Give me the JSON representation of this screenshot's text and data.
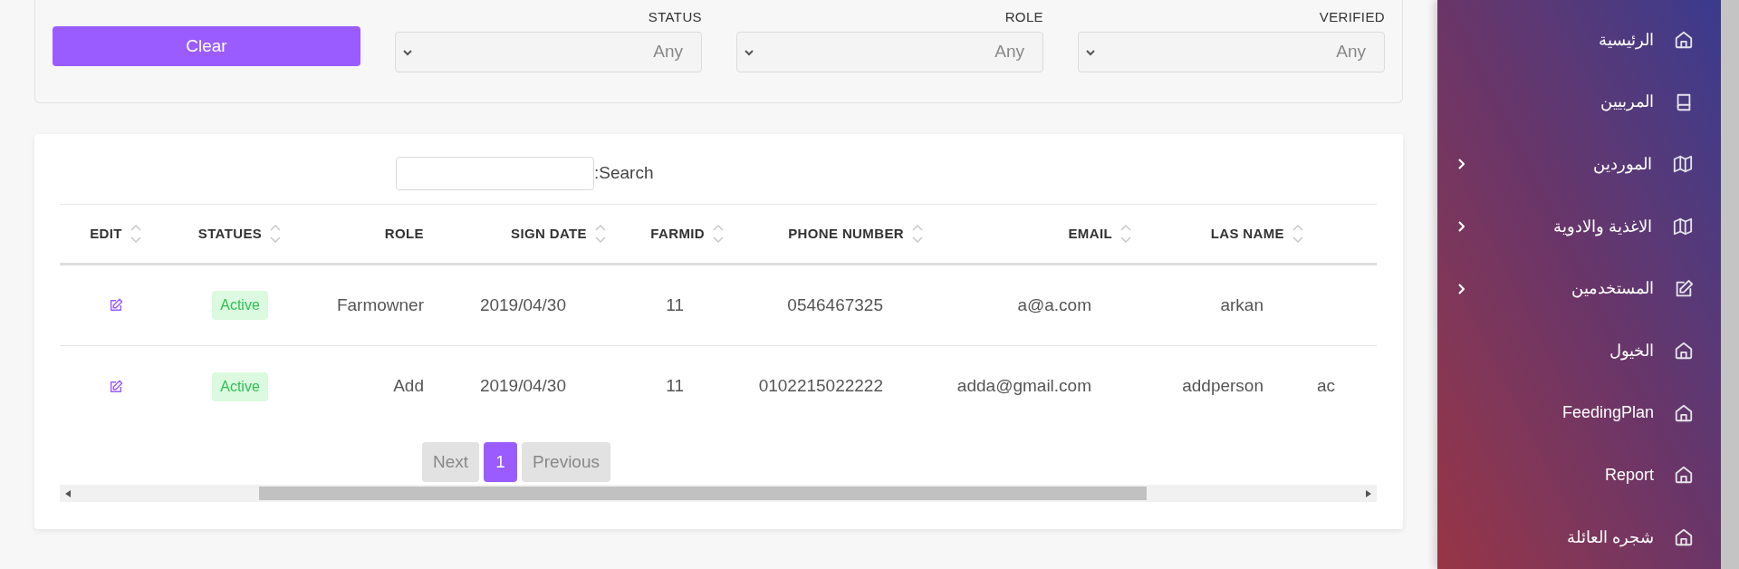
{
  "filters": {
    "clear_button": "Clear",
    "selects": [
      {
        "label": "STATUS",
        "value": "Any"
      },
      {
        "label": "ROLE",
        "value": "Any"
      },
      {
        "label": "VERIFIED",
        "value": "Any"
      }
    ]
  },
  "table": {
    "search_label": ":Search",
    "columns": [
      {
        "label": "EDIT",
        "sortable": true
      },
      {
        "label": "STATUES",
        "sortable": true
      },
      {
        "label": "ROLE",
        "sortable": false
      },
      {
        "label": "SIGN DATE",
        "sortable": true
      },
      {
        "label": "FARMID",
        "sortable": true
      },
      {
        "label": "PHONE NUMBER",
        "sortable": true
      },
      {
        "label": "EMAIL",
        "sortable": true
      },
      {
        "label": "LAS NAME",
        "sortable": true
      },
      {
        "sortable": false
      }
    ],
    "rows": [
      {
        "cells": [
          "",
          "Active",
          "Farmowner",
          "2019/04/30",
          "11",
          "0546467325",
          "a@a.com",
          "arkan"
        ]
      },
      {
        "cells": [
          "",
          "Active",
          "Add",
          "2019/04/30",
          "11",
          "0102215022222",
          "adda@gmail.com",
          "addperson",
          "ac"
        ]
      }
    ]
  },
  "pagination": {
    "next": "Next",
    "pages": [
      {
        "label": "1",
        "selected": true
      }
    ],
    "previous": "Previous"
  },
  "sidebar": {
    "items": [
      {
        "label": "الرئيسية",
        "kind": "home",
        "expandable": false
      },
      {
        "label": "المربيين",
        "kind": "book",
        "expandable": false
      },
      {
        "label": "الموردين",
        "kind": "map",
        "expandable": true
      },
      {
        "label": "الاغذية والادوية",
        "kind": "map",
        "expandable": true
      },
      {
        "label": "المستخدمين",
        "kind": "edit",
        "expandable": true
      },
      {
        "label": "الخيول",
        "kind": "home",
        "expandable": false
      },
      {
        "label": "FeedingPlan",
        "kind": "home",
        "expandable": false
      },
      {
        "label": "Report",
        "kind": "home",
        "expandable": false
      },
      {
        "label": "شجره العائلة",
        "kind": "home",
        "expandable": false
      }
    ]
  }
}
